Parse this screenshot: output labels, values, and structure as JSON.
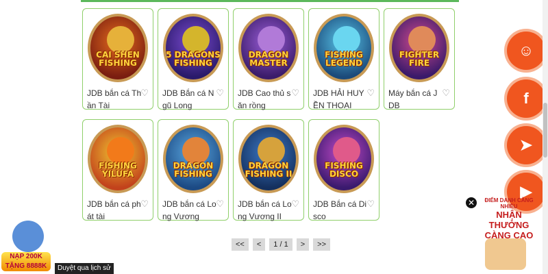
{
  "games": [
    {
      "logo": "CAI SHEN FISHING",
      "name": "JDB bắn cá Thần Tài"
    },
    {
      "logo": "5 DRAGONS FISHING",
      "name": "JDB Bắn cá Ngũ Long"
    },
    {
      "logo": "DRAGON MASTER",
      "name": "JDB Cao thủ săn rồng"
    },
    {
      "logo": "FISHING LEGEND",
      "name": "JDB HẢI HUYỀN THOẠI"
    },
    {
      "logo": "FIGHTER FIRE",
      "name": "Máy bắn cá JDB"
    },
    {
      "logo": "FISHING YILUFA",
      "name": "JDB bắn cá phát tài"
    },
    {
      "logo": "DRAGON FISHING",
      "name": "JDB bắn cá Long Vương"
    },
    {
      "logo": "DRAGON FISHING II",
      "name": "JDB bắn cá Long Vương II"
    },
    {
      "logo": "FISHING DISCO",
      "name": "JDB Bắn cá Disco"
    }
  ],
  "pagination": {
    "first": "<<",
    "prev": "<",
    "current": "1 / 1",
    "next": ">",
    "last": ">>"
  },
  "social": {
    "facebook": "f",
    "telegram": "➤",
    "youtube": "▶"
  },
  "promo_left": {
    "line1": "NẠP 200K",
    "line2": "TẶNG 8888K"
  },
  "history_link": "Duyệt qua lịch sử",
  "promo_right": {
    "line1": "ĐIỂM DANH CĂNG NHIỀU",
    "line2": "NHẬN THƯỞNG",
    "line3": "CÀNG CAO"
  },
  "close_label": "✕",
  "heart_icon": "♡",
  "colors": {
    "accent": "#5cb85c",
    "social": "#f0561f",
    "card_border": "#8fcf6a"
  }
}
